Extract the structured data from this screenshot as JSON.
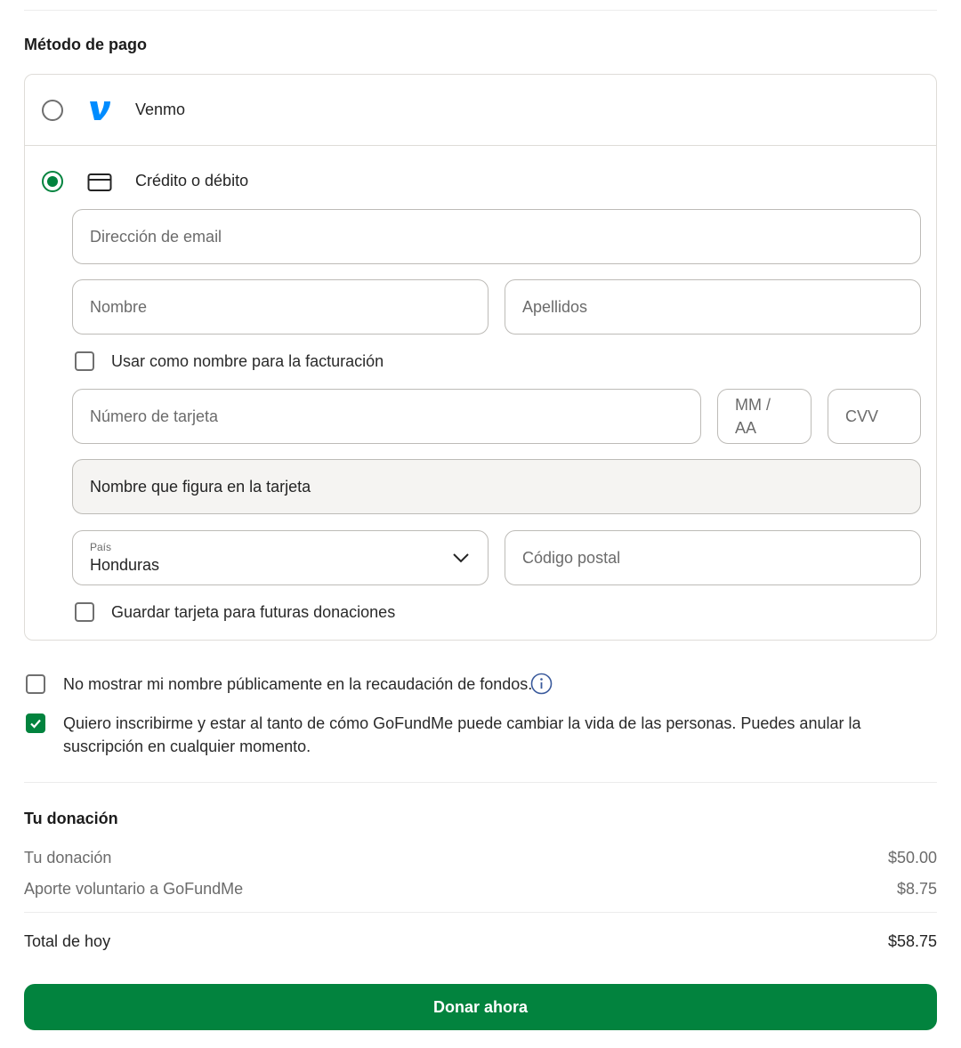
{
  "payment": {
    "title": "Método de pago",
    "venmo_label": "Venmo",
    "card_label": "Crédito o débito",
    "selected": "card",
    "email_placeholder": "Dirección de email",
    "first_name_placeholder": "Nombre",
    "last_name_placeholder": "Apellidos",
    "billing_name_label": "Usar como nombre para la facturación",
    "billing_name_checked": false,
    "card_number_placeholder": "Número de tarjeta",
    "expiry_placeholder": "MM / AA",
    "cvv_placeholder": "CVV",
    "cardholder_name": "Nombre que figura en la tarjeta",
    "country_label": "País",
    "country_value": "Honduras",
    "postal_code_placeholder": "Código postal",
    "save_card_label": "Guardar tarjeta para futuras donaciones",
    "save_card_checked": false
  },
  "options": {
    "hide_name_label": "No mostrar mi nombre públicamente en la recaudación de fondos.",
    "hide_name_checked": false,
    "subscribe_label": "Quiero inscribirme y estar al tanto de cómo GoFundMe puede cambiar la vida de las personas. Puedes anular la suscripción en cualquier momento.",
    "subscribe_checked": true
  },
  "summary": {
    "title": "Tu donación",
    "donation_label": "Tu donación",
    "donation_value": "$50.00",
    "tip_label": "Aporte voluntario a GoFundMe",
    "tip_value": "$8.75",
    "total_label": "Total de hoy",
    "total_value": "$58.75"
  },
  "donate_button_label": "Donar ahora",
  "colors": {
    "accent": "#02833e",
    "venmo_blue": "#008cff",
    "info_blue": "#3a5a9c"
  },
  "icons": {
    "venmo": "venmo-logo-icon",
    "card": "credit-card-icon",
    "dropdown": "chevron-down-icon",
    "info": "info-icon",
    "check": "check-icon"
  }
}
